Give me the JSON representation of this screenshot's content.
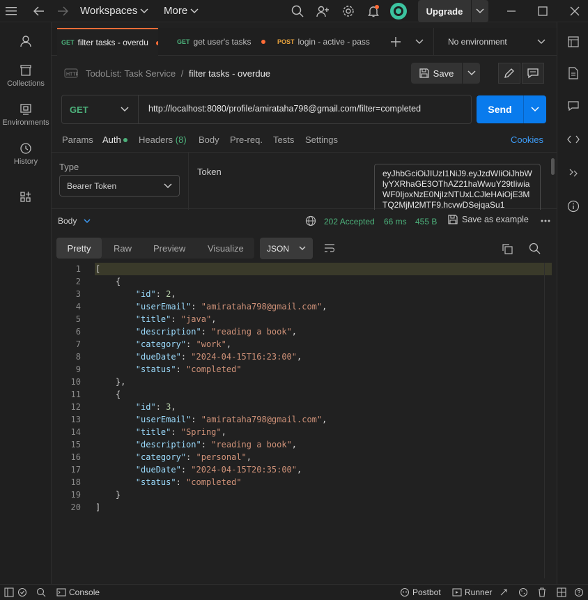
{
  "titlebar": {
    "workspaces": "Workspaces",
    "more": "More",
    "upgrade": "Upgrade"
  },
  "sidebar": {
    "items": [
      {
        "label": "Collections",
        "icon": "collections-icon"
      },
      {
        "label": "Environments",
        "icon": "environments-icon"
      },
      {
        "label": "History",
        "icon": "history-icon"
      }
    ]
  },
  "tabs": [
    {
      "method": "GET",
      "name": "filter tasks - overdu",
      "method_color": "#4cb07a",
      "unsaved": true
    },
    {
      "method": "GET",
      "name": "get user's tasks",
      "method_color": "#4cb07a",
      "unsaved": true
    },
    {
      "method": "POST",
      "name": "login - active - pass",
      "method_color": "#e8a33d",
      "unsaved": false
    }
  ],
  "environment": "No environment",
  "breadcrumb": {
    "collection": "TodoList: Task Service",
    "separator": "/",
    "request": "filter tasks - overdue"
  },
  "save_label": "Save",
  "request": {
    "method": "GET",
    "url": "http://localhost:8080/profile/amirataha798@gmail.com/filter=completed",
    "send_label": "Send"
  },
  "request_tabs": [
    "Params",
    "Auth",
    "Headers",
    "(8)",
    "Body",
    "Pre-req.",
    "Tests",
    "Settings"
  ],
  "cookies": "Cookies",
  "auth": {
    "type_label": "Type",
    "type_value": "Bearer Token",
    "token_label": "Token",
    "token_value": "eyJhbGciOiJIUzI1NiJ9.eyJzdWIiOiJhbWlyYXRhaGE3OThAZ21haWwuY29tIiwiaWF0IjoxNzE0NjIzNTUxLCJleHAiOjE3MTQ2MjM2MTF9.hcvwDSejqaSu1"
  },
  "response": {
    "body_label": "Body",
    "status": "202 Accepted",
    "time": "66 ms",
    "size": "455 B",
    "save_example": "Save as example",
    "tabs": [
      "Pretty",
      "Raw",
      "Preview",
      "Visualize"
    ],
    "format": "JSON"
  },
  "code_lines": [
    "1",
    "2",
    "3",
    "4",
    "5",
    "6",
    "7",
    "8",
    "9",
    "10",
    "11",
    "12",
    "13",
    "14",
    "15",
    "16",
    "17",
    "18",
    "19",
    "20"
  ],
  "json": {
    "open_bracket": "[",
    "close_bracket": "]",
    "items": [
      {
        "id": 2,
        "userEmail": "amirataha798@gmail.com",
        "title": "java",
        "description": "reading a book",
        "category": "work",
        "dueDate": "2024-04-15T16:23:00",
        "status": "completed"
      },
      {
        "id": 3,
        "userEmail": "amirataha798@gmail.com",
        "title": "Spring",
        "description": "reading a book",
        "category": "personal",
        "dueDate": "2024-04-15T20:35:00",
        "status": "completed"
      }
    ]
  },
  "statusbar": {
    "console": "Console",
    "postbot": "Postbot",
    "runner": "Runner"
  },
  "colors": {
    "accent": "#ff6c37",
    "send": "#097bed",
    "success": "#4cb07a"
  }
}
